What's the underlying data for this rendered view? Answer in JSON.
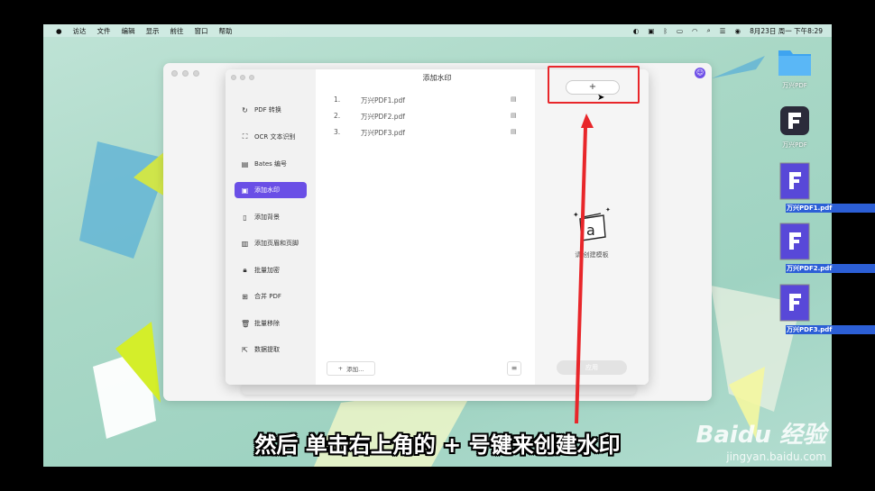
{
  "menubar": {
    "apple": "",
    "items": [
      "访达",
      "文件",
      "编辑",
      "显示",
      "前往",
      "窗口",
      "帮助"
    ],
    "datetime": "8月23日 周一 下午8:29"
  },
  "dialog": {
    "title": "添加水印"
  },
  "sidebar": {
    "items": [
      {
        "label": "PDF 转换",
        "icon": "refresh-icon"
      },
      {
        "label": "OCR 文本识别",
        "icon": "scan-icon"
      },
      {
        "label": "Bates 编号",
        "icon": "bates-icon"
      },
      {
        "label": "添加水印",
        "icon": "watermark-icon",
        "active": true
      },
      {
        "label": "添加背景",
        "icon": "background-icon"
      },
      {
        "label": "添加页眉和页脚",
        "icon": "header-footer-icon"
      },
      {
        "label": "批量加密",
        "icon": "lock-icon"
      },
      {
        "label": "合并 PDF",
        "icon": "merge-icon"
      },
      {
        "label": "批量移除",
        "icon": "trash-icon"
      },
      {
        "label": "数据提取",
        "icon": "extract-icon"
      }
    ]
  },
  "files": [
    {
      "num": "1.",
      "name": "万兴PDF1.pdf"
    },
    {
      "num": "2.",
      "name": "万兴PDF2.pdf"
    },
    {
      "num": "3.",
      "name": "万兴PDF3.pdf"
    }
  ],
  "actions": {
    "add_label": "添加...",
    "add_icon": "+",
    "plus_label": "+",
    "empty_text": "请 创建模板",
    "apply_label": "应用"
  },
  "desktop": [
    {
      "label": "万兴PDF",
      "kind": "folder"
    },
    {
      "label": "万兴PDF",
      "kind": "app"
    },
    {
      "label": "万兴PDF1.pdf",
      "kind": "file"
    },
    {
      "label": "万兴PDF2.pdf",
      "kind": "file"
    },
    {
      "label": "万兴PDF3.pdf",
      "kind": "file"
    }
  ],
  "caption": "然后 单击右上角的 + 号键来创建水印",
  "watermark": {
    "brand": "Baidu 经验",
    "url": "jingyan.baidu.com"
  },
  "colors": {
    "accent": "#6a4fe6",
    "highlight": "#e8262a"
  }
}
